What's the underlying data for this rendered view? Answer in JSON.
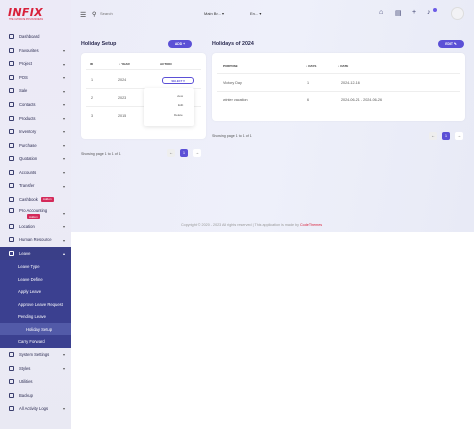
{
  "brand": {
    "logo_text": "INFIX",
    "logo_sub": "THE ULTIMATE POS BUSINESS"
  },
  "topbar": {
    "search_placeholder": "Search",
    "branch": "Main Br...",
    "lang": "En..."
  },
  "sidebar": {
    "items": [
      {
        "label": "Dashboard"
      },
      {
        "label": "Favourites"
      },
      {
        "label": "Project"
      },
      {
        "label": "POS"
      },
      {
        "label": "Sale"
      },
      {
        "label": "Contacts"
      },
      {
        "label": "Products"
      },
      {
        "label": "Inventory"
      },
      {
        "label": "Purchase"
      },
      {
        "label": "Quotation"
      },
      {
        "label": "Accounts"
      },
      {
        "label": "Transfer"
      },
      {
        "label": "Cashbook",
        "badge": "Addon"
      },
      {
        "label": "Pro Accounting",
        "badge": "Addon"
      },
      {
        "label": "Location"
      },
      {
        "label": "Human Resource"
      },
      {
        "label": "Leave"
      }
    ],
    "leave_sub": [
      "Leave Type",
      "Leave Define",
      "Apply Leave",
      "Approve Leave Request",
      "Pending Leave",
      "Holiday Setup",
      "Carry Forward"
    ],
    "bottom": [
      "System Settings",
      "Styles",
      "Utilities",
      "Backup",
      "All Activity Logs"
    ]
  },
  "holiday_setup": {
    "title": "Holiday Setup",
    "add_label": "ADD",
    "columns": [
      "ID",
      "YEAR",
      "ACTION"
    ],
    "rows": [
      {
        "id": "1",
        "year": "2024"
      },
      {
        "id": "2",
        "year": "2023"
      },
      {
        "id": "3",
        "year": "2015"
      }
    ],
    "select_label": "SELECT",
    "dropdown": [
      "view",
      "Edit",
      "Delete"
    ],
    "pager": "Showing page 1 to 1 of 1",
    "page": "1"
  },
  "holidays_2024": {
    "title": "Holidays of 2024",
    "edit_label": "EDIT",
    "columns": [
      "PURPOSE",
      "DAYS",
      "DATE"
    ],
    "rows": [
      {
        "purpose": "Victory Day",
        "days": "1",
        "date": "2024-12-16"
      },
      {
        "purpose": "winter vacation",
        "days": "6",
        "date": "2024-06-21 - 2024-06-26"
      }
    ],
    "pager": "Showing page 1 to 1 of 1",
    "page": "1"
  },
  "footer": {
    "text": "Copyright © 2020 - 2023 All rights reserved | This application is made by",
    "brand": "CodeThemes"
  }
}
